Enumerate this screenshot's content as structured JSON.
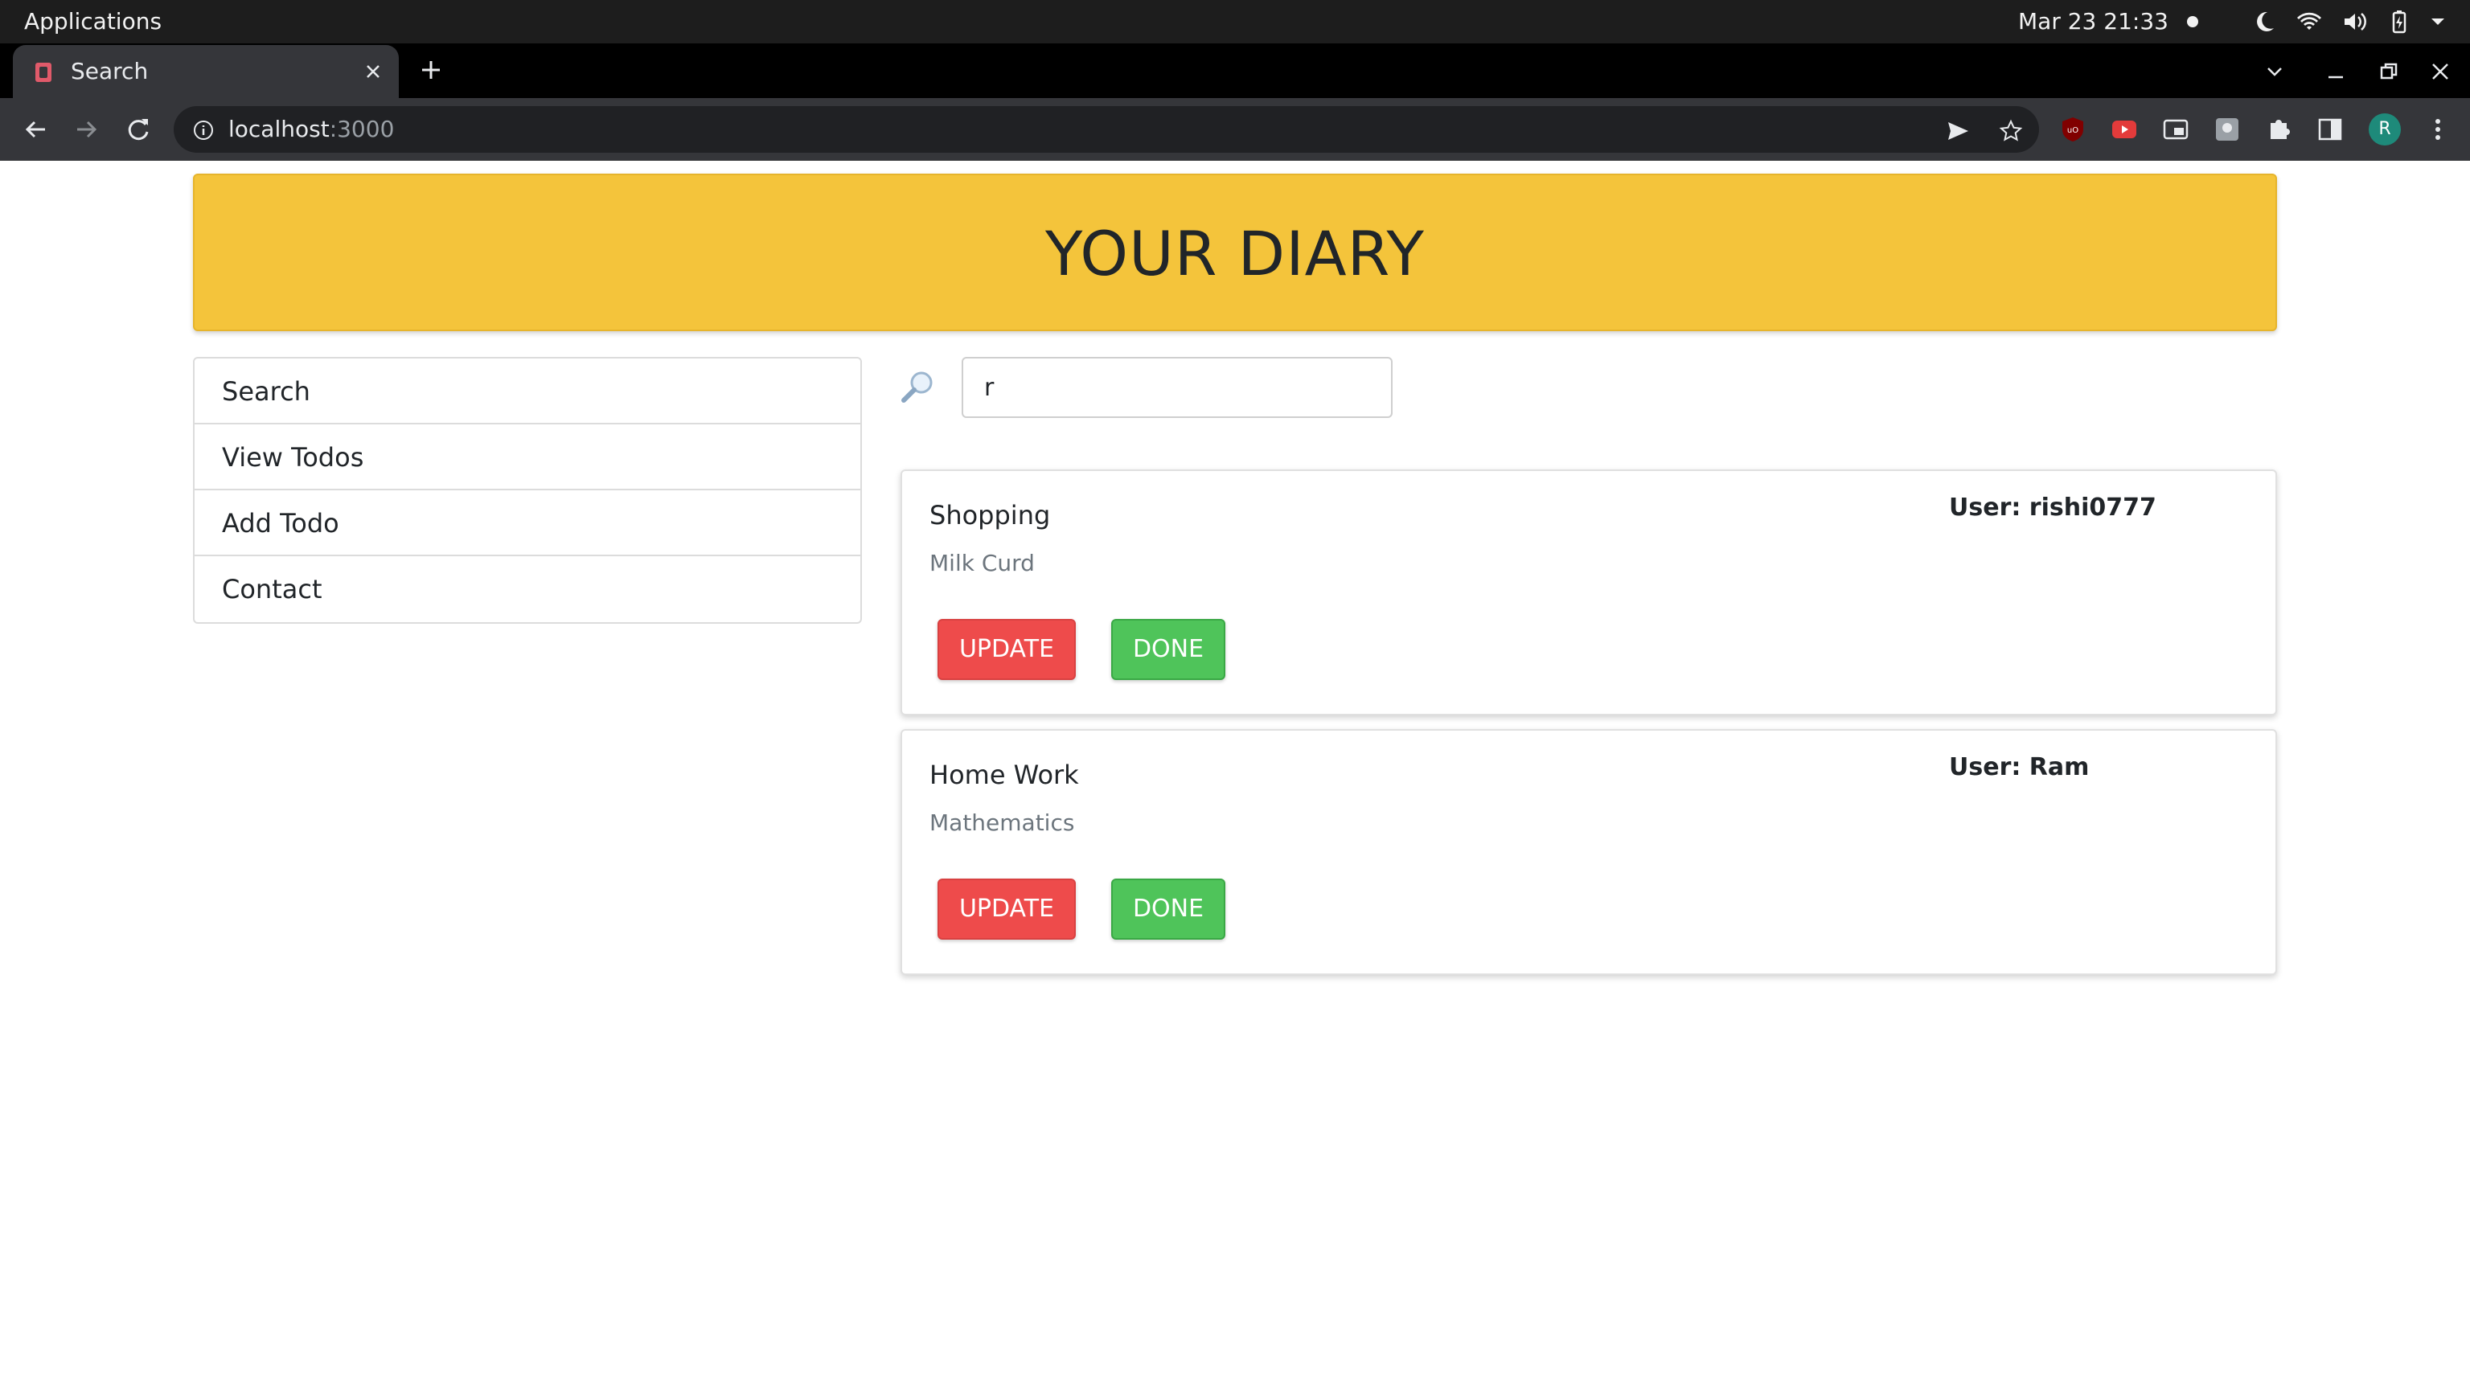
{
  "system_bar": {
    "applications_label": "Applications",
    "clock": "Mar 23  21:33",
    "tray_icons": [
      "notification-dot",
      "night-light-icon",
      "wifi-icon",
      "volume-icon",
      "battery-icon",
      "system-menu-chevron-icon"
    ]
  },
  "browser": {
    "tab": {
      "title": "Search",
      "favicon": "app-favicon"
    },
    "address": {
      "host": "localhost",
      "port": ":3000"
    },
    "toolbar_icons": [
      "send-icon",
      "star-icon",
      "ublock-icon",
      "youtube-ext-icon",
      "pip-icon",
      "ext-icon",
      "puzzle-icon",
      "sidepanel-icon",
      "menu-icon"
    ],
    "profile_initial": "R"
  },
  "app": {
    "header_title": "YOUR DIARY",
    "accent_color": "#f4c43b",
    "sidebar": {
      "items": [
        {
          "label": "Search"
        },
        {
          "label": "View Todos"
        },
        {
          "label": "Add Todo"
        },
        {
          "label": "Contact"
        }
      ]
    },
    "search": {
      "value": "r"
    },
    "todos": [
      {
        "title": "Shopping",
        "description": "Milk Curd",
        "user": "User: rishi0777",
        "update_label": "UPDATE",
        "done_label": "DONE"
      },
      {
        "title": "Home Work",
        "description": "Mathematics",
        "user": "User: Ram",
        "update_label": "UPDATE",
        "done_label": "DONE"
      }
    ]
  }
}
